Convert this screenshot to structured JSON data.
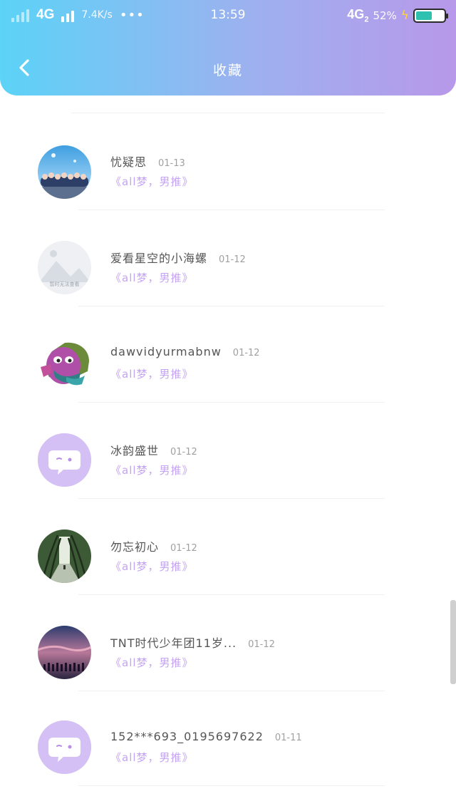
{
  "status_bar": {
    "network_left": "4G",
    "speed": "7.4K/s",
    "dots": "•••",
    "time": "13:59",
    "network_right": "4G",
    "network_right_sub": "2",
    "battery_percent": "52%",
    "battery_level": 0.52
  },
  "header": {
    "title": "收藏",
    "back_icon": "chevron-left-icon"
  },
  "items": [
    {
      "nickname": "忧疑思",
      "date": "01-13",
      "message": "《all梦，男推》",
      "avatar": "group-photo"
    },
    {
      "nickname": "爱看星空的小海螺",
      "date": "01-12",
      "message": "《all梦，男推》",
      "avatar": "placeholder-image"
    },
    {
      "nickname": "dawvidyurmabnw",
      "date": "01-12",
      "message": "《all梦，男推》",
      "avatar": "cartoon-face"
    },
    {
      "nickname": "冰韵盛世",
      "date": "01-12",
      "message": "《all梦，男推》",
      "avatar": "default-chat"
    },
    {
      "nickname": "勿忘初心",
      "date": "01-12",
      "message": "《all梦，男推》",
      "avatar": "tree-tunnel"
    },
    {
      "nickname": "TNT时代少年团11岁...",
      "date": "01-12",
      "message": "《all梦，男推》",
      "avatar": "sunset-crowd"
    },
    {
      "nickname": "152***693_0195697622",
      "date": "01-11",
      "message": "《all梦，男推》",
      "avatar": "default-chat"
    }
  ],
  "placeholder_caption": "暂时无法查看",
  "colors": {
    "header_start": "#5cd3f7",
    "header_end": "#b898ea",
    "message": "#c4a4f2",
    "default_avatar": "#d4c0f4"
  }
}
